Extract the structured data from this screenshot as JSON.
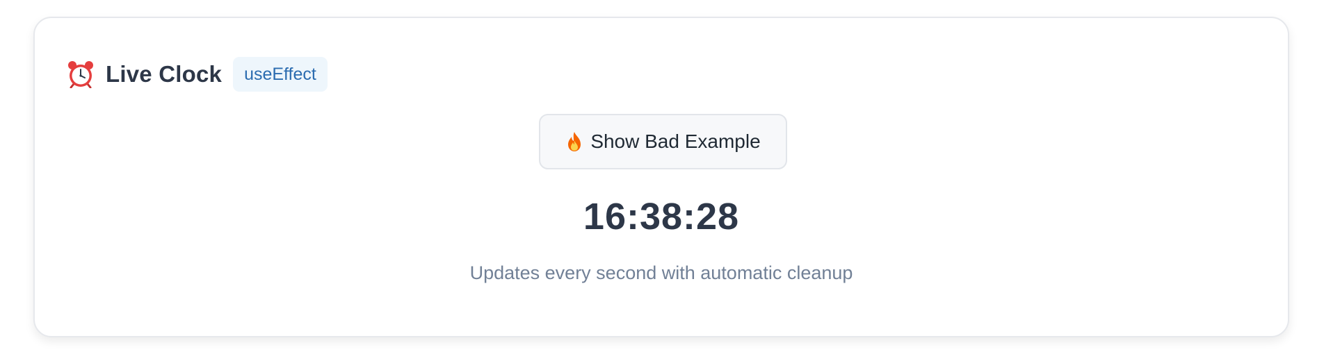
{
  "card": {
    "title": "Live Clock",
    "badge": "useEffect",
    "title_icon": "alarm-clock-icon",
    "button": {
      "label": "Show Bad Example",
      "icon": "fire-icon"
    },
    "time": "16:38:28",
    "subtitle": "Updates every second with automatic cleanup"
  },
  "colors": {
    "badge_bg": "#eef6fc",
    "badge_text": "#2b6cb0",
    "title_text": "#2d3748",
    "subtitle_text": "#718096",
    "button_bg": "#f7f8fa",
    "button_border": "#e2e5ea"
  }
}
